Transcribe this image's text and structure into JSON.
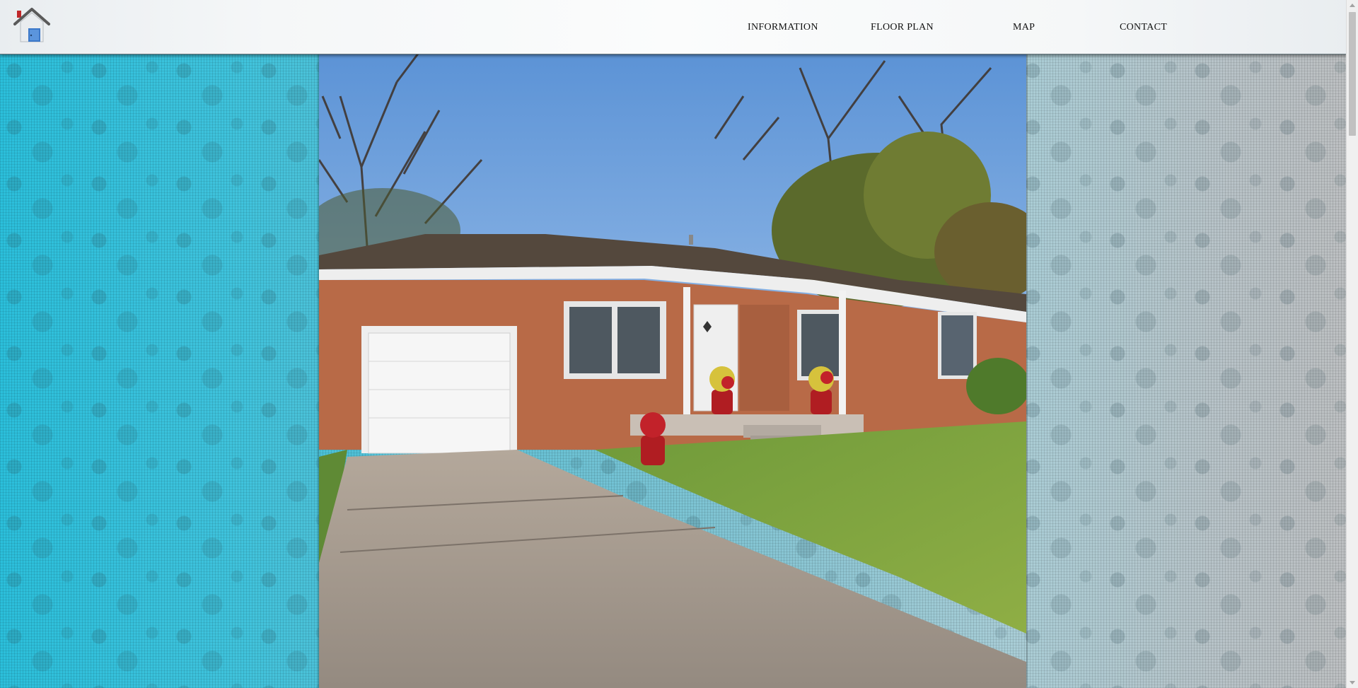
{
  "nav": {
    "logo_icon": "house-icon",
    "links": [
      {
        "label": "INFORMATION"
      },
      {
        "label": "FLOOR PLAN"
      },
      {
        "label": "MAP"
      },
      {
        "label": "CONTACT"
      }
    ]
  },
  "hero": {
    "image_subject": "house-photo"
  },
  "colors": {
    "bg_left": "#2bbfdb",
    "bg_right": "#bcbfc1",
    "navbar": "#f7f9fa",
    "nav_text": "#111111"
  }
}
